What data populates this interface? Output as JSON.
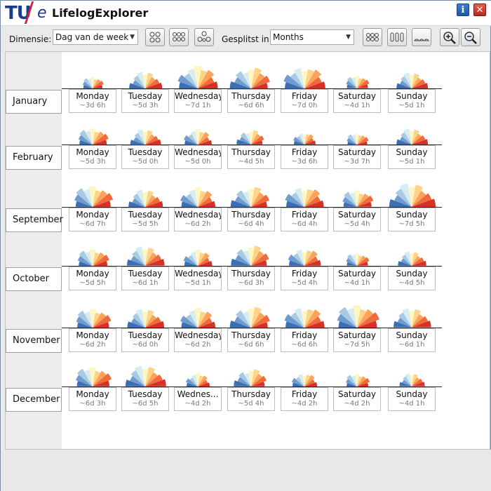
{
  "window": {
    "title": "LifelogExplorer",
    "logo_tu": "TU",
    "logo_e": "e",
    "info_label": "i",
    "close_label": "✕"
  },
  "toolbar": {
    "dimension_label": "Dimensie:",
    "dimension_value": "Dag van de week",
    "split_label": "Gesplitst in:",
    "split_value": "Months",
    "zoom_in_icon": "zoom-in-icon",
    "zoom_out_icon": "zoom-out-icon"
  },
  "colors": {
    "palette": [
      "#3a6eb5",
      "#6f9bcf",
      "#a8cbe3",
      "#d6ecf3",
      "#fff6c2",
      "#fed38a",
      "#fca35a",
      "#f06a3c",
      "#d73027"
    ]
  },
  "rows": [
    {
      "label": "January",
      "days": [
        {
          "name": "Monday",
          "value": "~3d 6h"
        },
        {
          "name": "Tuesday",
          "value": "~5d 3h"
        },
        {
          "name": "Wednesday",
          "value": "~7d 1h"
        },
        {
          "name": "Thursday",
          "value": "~6d 6h"
        },
        {
          "name": "Friday",
          "value": "~7d 0h"
        },
        {
          "name": "Saturday",
          "value": "~4d 1h"
        },
        {
          "name": "Sunday",
          "value": "~5d 1h"
        }
      ]
    },
    {
      "label": "February",
      "days": [
        {
          "name": "Monday",
          "value": "~5d 3h"
        },
        {
          "name": "Tuesday",
          "value": "~5d 0h"
        },
        {
          "name": "Wednesday",
          "value": "~5d 0h"
        },
        {
          "name": "Thursday",
          "value": "~4d 5h"
        },
        {
          "name": "Friday",
          "value": "~3d 6h"
        },
        {
          "name": "Saturday",
          "value": "~3d 7h"
        },
        {
          "name": "Sunday",
          "value": "~5d 1h"
        }
      ]
    },
    {
      "label": "September",
      "days": [
        {
          "name": "Monday",
          "value": "~6d 7h"
        },
        {
          "name": "Tuesday",
          "value": "~5d 5h"
        },
        {
          "name": "Wednesday",
          "value": "~6d 2h"
        },
        {
          "name": "Thursday",
          "value": "~6d 4h"
        },
        {
          "name": "Friday",
          "value": "~6d 4h"
        },
        {
          "name": "Saturday",
          "value": "~5d 4h"
        },
        {
          "name": "Sunday",
          "value": "~7d 5h"
        }
      ]
    },
    {
      "label": "October",
      "days": [
        {
          "name": "Monday",
          "value": "~5d 5h"
        },
        {
          "name": "Tuesday",
          "value": "~6d 1h"
        },
        {
          "name": "Wednesday",
          "value": "~5d 1h"
        },
        {
          "name": "Thursday",
          "value": "~6d 3h"
        },
        {
          "name": "Friday",
          "value": "~5d 4h"
        },
        {
          "name": "Saturday",
          "value": "~4d 1h"
        },
        {
          "name": "Sunday",
          "value": "~4d 5h"
        }
      ]
    },
    {
      "label": "November",
      "days": [
        {
          "name": "Monday",
          "value": "~6d 2h"
        },
        {
          "name": "Tuesday",
          "value": "~6d 0h"
        },
        {
          "name": "Wednesday",
          "value": "~6d 2h"
        },
        {
          "name": "Thursday",
          "value": "~6d 6h"
        },
        {
          "name": "Friday",
          "value": "~6d 6h"
        },
        {
          "name": "Saturday",
          "value": "~7d 5h"
        },
        {
          "name": "Sunday",
          "value": "~6d 1h"
        }
      ]
    },
    {
      "label": "December",
      "days": [
        {
          "name": "Monday",
          "value": "~6d 3h"
        },
        {
          "name": "Tuesday",
          "value": "~6d 5h"
        },
        {
          "name": "Wednes...",
          "value": "~4d 2h"
        },
        {
          "name": "Thursday",
          "value": "~5d 4h"
        },
        {
          "name": "Friday",
          "value": "~4d 2h"
        },
        {
          "name": "Saturday",
          "value": "~4d 2h"
        },
        {
          "name": "Sunday",
          "value": "~4d 1h"
        }
      ]
    }
  ]
}
